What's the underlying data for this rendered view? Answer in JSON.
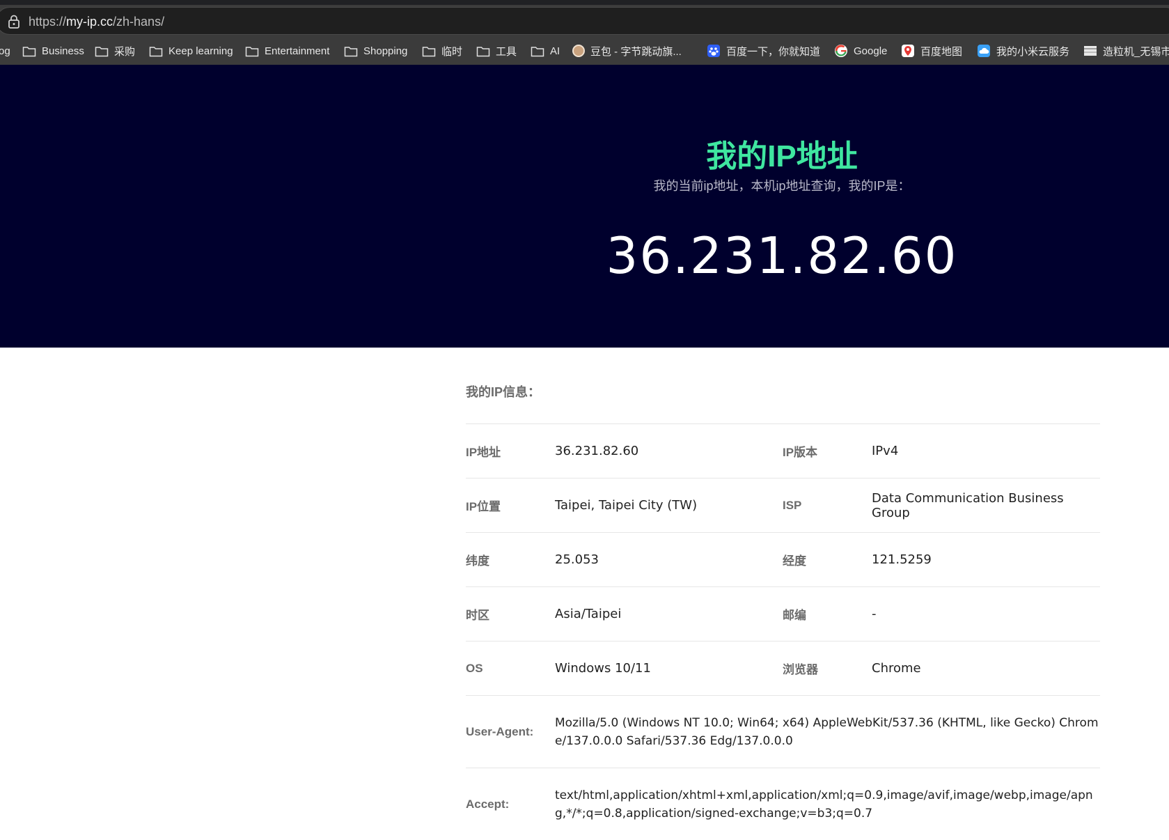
{
  "browser": {
    "url_prefix": "https://",
    "url_host": "my-ip.cc",
    "url_path": "/zh-hans/",
    "bookmarks": [
      {
        "label": "og",
        "icon": "folder-icon"
      },
      {
        "label": "Business",
        "icon": "folder-icon"
      },
      {
        "label": "采购",
        "icon": "folder-icon"
      },
      {
        "label": "Keep learning",
        "icon": "folder-icon"
      },
      {
        "label": "Entertainment",
        "icon": "folder-icon"
      },
      {
        "label": "Shopping",
        "icon": "folder-icon"
      },
      {
        "label": "临时",
        "icon": "folder-icon"
      },
      {
        "label": "工具",
        "icon": "folder-icon"
      },
      {
        "label": "AI",
        "icon": "folder-icon"
      },
      {
        "label": "豆包 - 字节跳动旗...",
        "icon": "doubao-favicon",
        "color": "#c9a27e"
      },
      {
        "label": "百度一下，你就知道",
        "icon": "baidu-favicon",
        "color": "#2f5ff5"
      },
      {
        "label": "Google",
        "icon": "google-favicon",
        "color": "#ea4335"
      },
      {
        "label": "百度地图",
        "icon": "baidu-map-favicon",
        "color": "#e53935"
      },
      {
        "label": "我的小米云服务",
        "icon": "xiaomi-cloud-favicon",
        "color": "#3aa0f5"
      },
      {
        "label": "造粒机_无锡市",
        "icon": "site-favicon",
        "color": "#bdbdbd"
      }
    ]
  },
  "hero": {
    "title": "我的IP地址",
    "subtitle": "我的当前ip地址，本机ip地址查询，我的IP是：",
    "ip": "36.231.82.60",
    "title_color": "#3fe6a0",
    "background": "#00002d"
  },
  "info": {
    "heading": "我的IP信息：",
    "rows": [
      {
        "l1": "IP地址",
        "v1": "36.231.82.60",
        "l2": "IP版本",
        "v2": "IPv4"
      },
      {
        "l1": "IP位置",
        "v1": "Taipei, Taipei City (TW)",
        "l2": "ISP",
        "v2": "Data Communication Business Group"
      },
      {
        "l1": "纬度",
        "v1": "25.053",
        "l2": "经度",
        "v2": "121.5259"
      },
      {
        "l1": "时区",
        "v1": "Asia/Taipei",
        "l2": "邮编",
        "v2": "-"
      },
      {
        "l1": "OS",
        "v1": "Windows 10/11",
        "l2": "浏览器",
        "v2": "Chrome"
      }
    ],
    "user_agent_label": "User-Agent:",
    "user_agent": "Mozilla/5.0 (Windows NT 10.0; Win64; x64) AppleWebKit/537.36 (KHTML, like Gecko) Chrome/137.0.0.0 Safari/537.36 Edg/137.0.0.0",
    "accept_label": "Accept:",
    "accept": "text/html,application/xhtml+xml,application/xml;q=0.9,image/avif,image/webp,image/apng,*/*;q=0.8,application/signed-exchange;v=b3;q=0.7"
  }
}
